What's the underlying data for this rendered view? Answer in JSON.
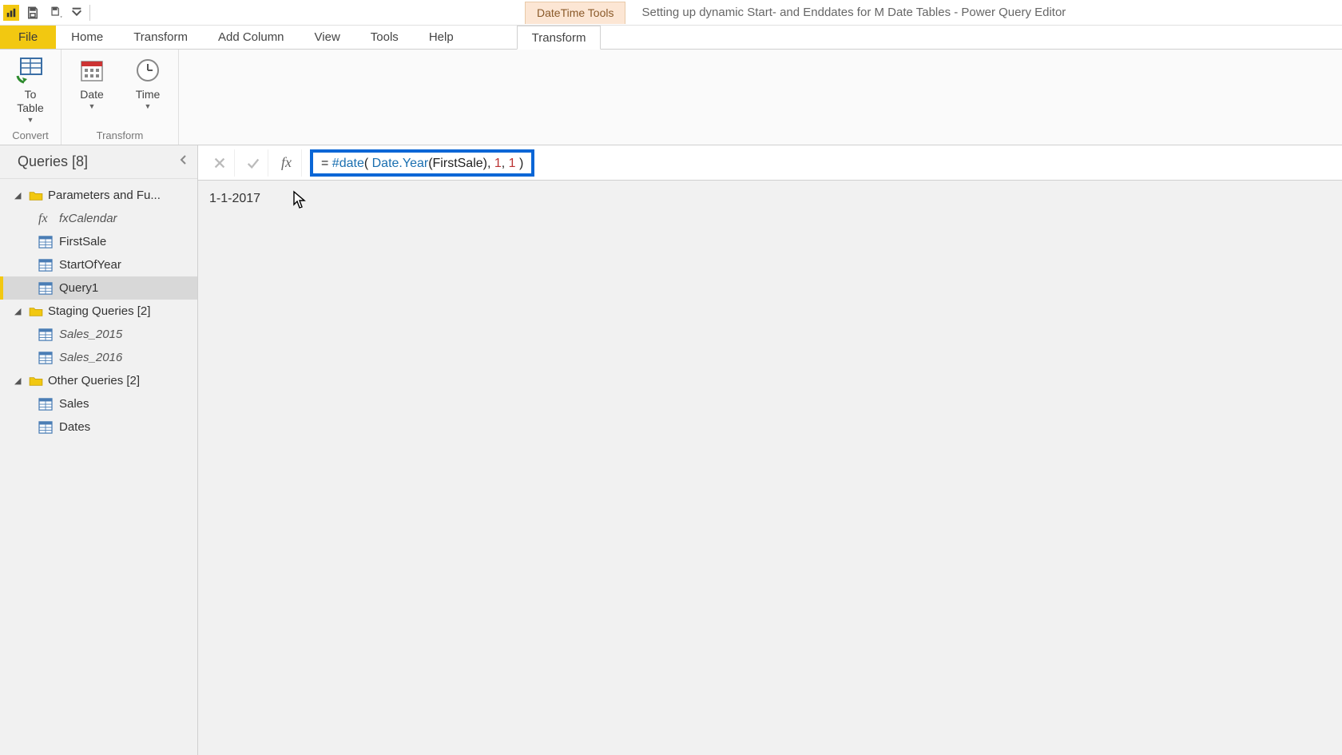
{
  "titlebar": {
    "context_tool_name": "DateTime Tools",
    "window_title": "Setting up dynamic Start- and Enddates for M Date Tables - Power Query Editor"
  },
  "tabs": {
    "file": "File",
    "home": "Home",
    "transform": "Transform",
    "add_column": "Add Column",
    "view": "View",
    "tools": "Tools",
    "help": "Help",
    "context_transform": "Transform"
  },
  "ribbon": {
    "convert": {
      "to_table": "To\nTable",
      "group_label": "Convert"
    },
    "transform": {
      "date": "Date",
      "time": "Time",
      "group_label": "Transform"
    }
  },
  "sidebar": {
    "header": "Queries [8]",
    "groups": [
      {
        "name": "Parameters and Fu...",
        "items": [
          {
            "label": "fxCalendar",
            "type": "fx",
            "italic": true
          },
          {
            "label": "FirstSale",
            "type": "table"
          },
          {
            "label": "StartOfYear",
            "type": "table"
          },
          {
            "label": "Query1",
            "type": "table",
            "selected": true
          }
        ]
      },
      {
        "name": "Staging Queries [2]",
        "items": [
          {
            "label": "Sales_2015",
            "type": "table",
            "italic": true
          },
          {
            "label": "Sales_2016",
            "type": "table",
            "italic": true
          }
        ]
      },
      {
        "name": "Other Queries [2]",
        "items": [
          {
            "label": "Sales",
            "type": "table"
          },
          {
            "label": "Dates",
            "type": "table"
          }
        ]
      }
    ]
  },
  "formula": {
    "prefix": "= ",
    "fn": "#date",
    "open": "( ",
    "arg1a": "Date.Year",
    "arg1b": "(FirstSale), ",
    "num1": "1",
    "sep": ", ",
    "num2": "1",
    "close": " )"
  },
  "result": {
    "value": "1-1-2017"
  }
}
